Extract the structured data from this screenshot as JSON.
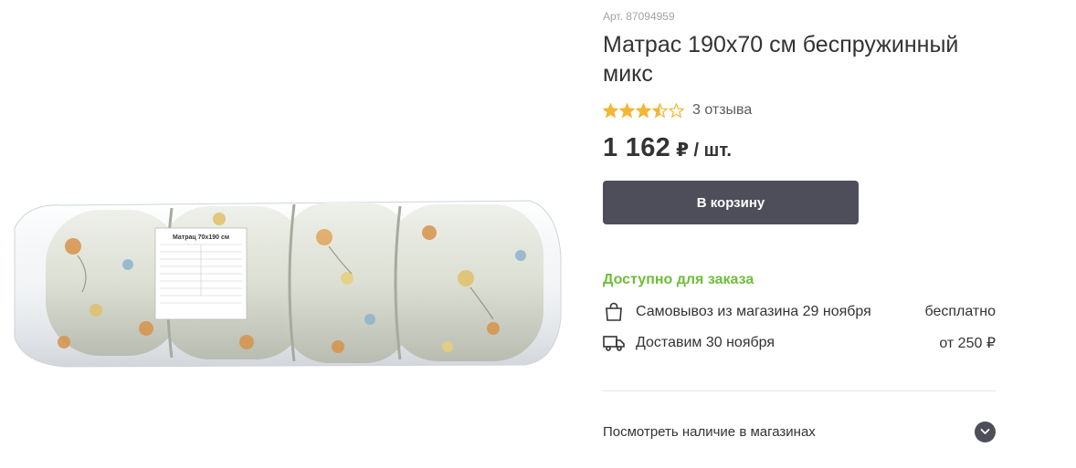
{
  "product": {
    "sku": "Арт. 87094959",
    "title": "Матрас 190х70 см беспружинный микс",
    "rating": {
      "value": 3.5,
      "max": 5
    },
    "reviews": "3 отзыва",
    "price": "1 162",
    "price_unit": "₽ / шт.",
    "image": {
      "label_title": "Матрац 70х190 см",
      "icon": "rolled-mattress-image"
    }
  },
  "cart": {
    "label": "В корзину"
  },
  "availability": {
    "status": "Доступно для заказа"
  },
  "delivery": [
    {
      "icon": "shopping-bag-icon",
      "label": "Самовывоз из магазина 29 ноября",
      "cost": "бесплатно"
    },
    {
      "icon": "truck-icon",
      "label": "Доставим 30 ноября",
      "cost": "от 250 ₽"
    }
  ],
  "stores": {
    "label": "Посмотреть наличие в магазинах"
  },
  "colors": {
    "accent_green": "#6cbf38",
    "button_dark": "#4d4e5a",
    "star": "#f2b636"
  }
}
